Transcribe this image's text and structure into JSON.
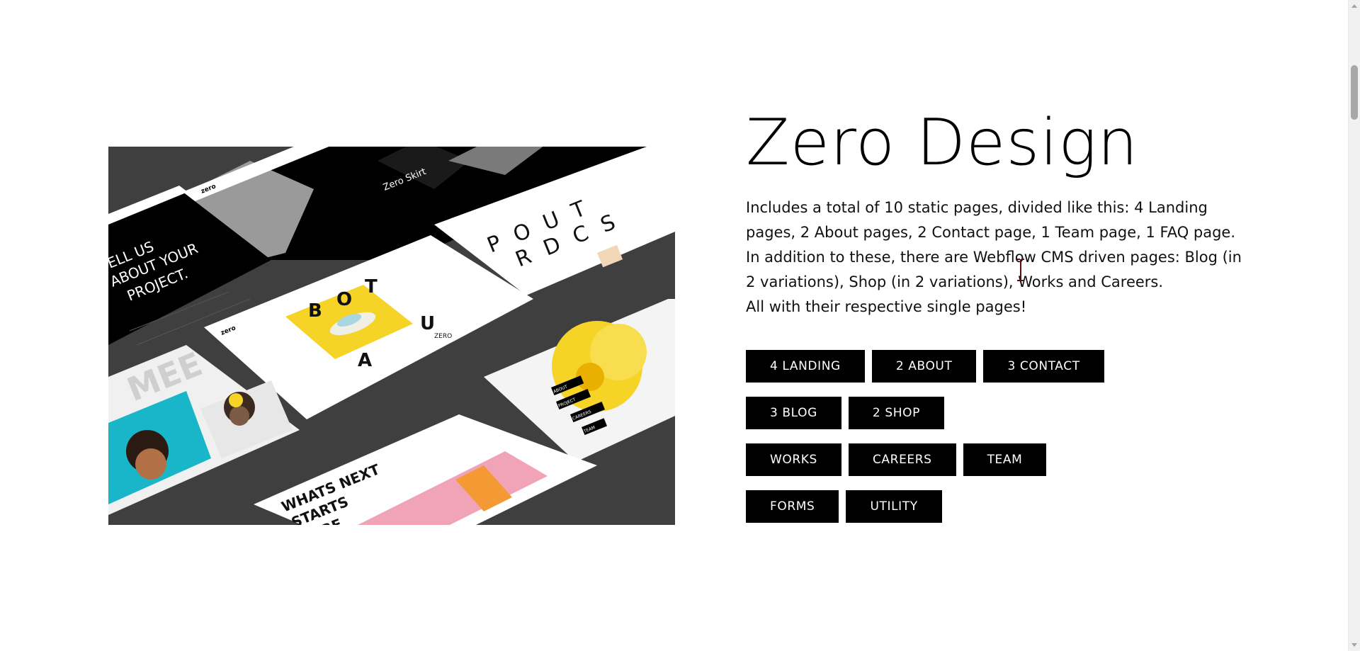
{
  "product": {
    "title": "Zero Design",
    "description": [
      "Includes a total of 10 static pages, divided like this: 4 Landing pages, 2 About pages, 2 Contact page, 1 Team page, 1 FAQ page. In addition to these, there are Webflow CMS driven pages: Blog (in 2 variations), Shop (in 2 variations), Works and Careers.",
      "All with their respective single pages!"
    ],
    "tags": [
      [
        "4 LANDING",
        "2 ABOUT",
        "3 CONTACT"
      ],
      [
        "3 BLOG",
        "2 SHOP"
      ],
      [
        "WORKS",
        "CAREERS",
        "TEAM"
      ],
      [
        "FORMS",
        "UTILITY"
      ]
    ]
  },
  "preview": {
    "texts": {
      "tell_us": "ELL US",
      "about_your": "ABOUT YOUR",
      "project": "PROJECT.",
      "zero_skirt": "Zero Skirt",
      "pout_line1": "P O U T",
      "pout_line2": "R D C S",
      "bota_b": "B",
      "bota_o": "O",
      "bota_t": "T",
      "bota_a": "A",
      "bota_u": "U",
      "zero_small": "ZERO",
      "mee": "MEE",
      "whats_next_1": "WHATS NEXT",
      "whats_next_2": "STARTS",
      "whats_next_3": "HERE",
      "menu_about": "ABOUT",
      "menu_project": "PROJECT",
      "menu_careers": "CAREERS",
      "menu_team": "TEAM",
      "logo": "zero"
    }
  },
  "colors": {
    "background": "#ffffff",
    "tag_bg": "#000000",
    "tag_text": "#ffffff",
    "preview_bg": "#3f3f3f",
    "accent_yellow": "#f5d327",
    "accent_pink": "#f1a3b8",
    "accent_cyan": "#19b5c8"
  },
  "scrollbar": {
    "thumb_color": "#a8a8a8"
  }
}
